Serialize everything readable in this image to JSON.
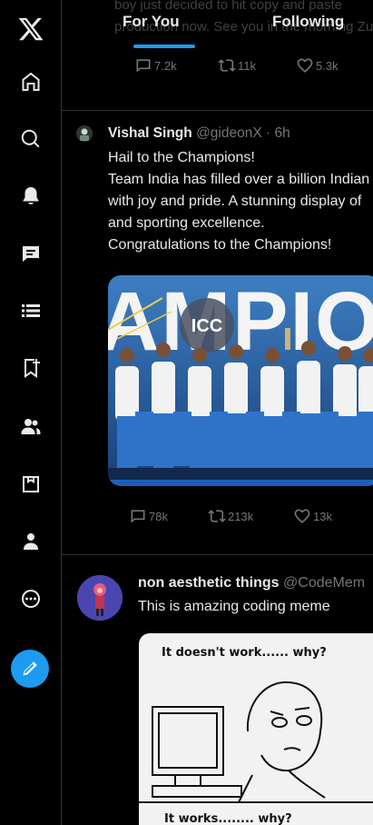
{
  "app": {
    "name": "X"
  },
  "header": {
    "ghost_text_line1": "boy just decided to hit copy and paste",
    "ghost_text_line2": "production now. See you in the morning Zuc",
    "tabs": [
      {
        "label": "For You",
        "active": true
      },
      {
        "label": "Following",
        "active": false
      }
    ]
  },
  "sidebar": {
    "items": [
      {
        "name": "home",
        "icon": "home-icon"
      },
      {
        "name": "explore",
        "icon": "search-icon"
      },
      {
        "name": "notifications",
        "icon": "bell-icon"
      },
      {
        "name": "messages",
        "icon": "messages-icon"
      },
      {
        "name": "lists",
        "icon": "lists-icon"
      },
      {
        "name": "bookmarks",
        "icon": "bookmarks-icon"
      },
      {
        "name": "communities",
        "icon": "communities-icon"
      },
      {
        "name": "premium",
        "icon": "premium-icon"
      },
      {
        "name": "profile",
        "icon": "profile-icon"
      },
      {
        "name": "more",
        "icon": "more-icon"
      }
    ],
    "compose_icon": "feather-pen-icon",
    "accent_color": "#1d9bf0"
  },
  "posts": [
    {
      "stats": {
        "replies": "7.2k",
        "reposts": "11k",
        "likes": "5.3k"
      }
    },
    {
      "author": "Vishal Singh",
      "handle": "@gideonX",
      "time": "· 6h",
      "lines": [
        "Hail to the Champions!",
        "Team India has filled over a billion Indian",
        "with joy and pride. A stunning display of",
        "and sporting excellence.",
        "Congratulations to the Champions!"
      ],
      "image_banner_text": "AMPIONS",
      "image_logo_text": "ICC",
      "stats": {
        "replies": "78k",
        "reposts": "213k",
        "likes": "13k"
      }
    },
    {
      "author": "non aesthetic things",
      "handle": "@CodeMem",
      "lines": [
        "This is amazing coding meme"
      ],
      "meme_top_text": "It doesn't work...... why?",
      "meme_bottom_text": "It works........  why?"
    }
  ]
}
